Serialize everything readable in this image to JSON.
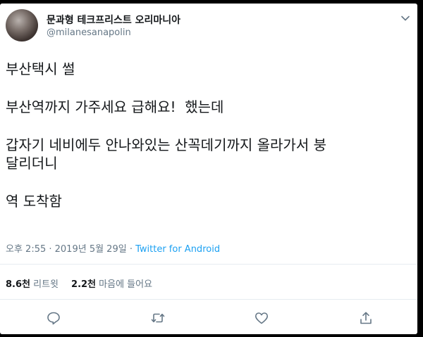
{
  "tweet": {
    "display_name": "문과형 테크프리스트 오리마니아",
    "handle": "@milanesanapolin",
    "paragraphs": [
      "부산택시 썰",
      "부산역까지 가주세요 급해요!  했는데",
      "갑자기 네비에두 안나와있는 산꼭데기까지 올라가서 붕\n달리더니",
      "역 도착함"
    ],
    "timestamp": "오후 2:55 · 2019년 5월 29일 · ",
    "source": "Twitter for Android",
    "retweet_count": "8.6천",
    "retweet_label": "리트윗",
    "like_count": "2.2천",
    "like_label": "마음에 들어요"
  },
  "icons": {
    "reply": "reply-icon",
    "retweet": "retweet-icon",
    "like": "heart-icon",
    "share": "share-icon",
    "menu": "chevron-down-icon"
  },
  "colors": {
    "text": "#14171a",
    "secondary": "#657786",
    "link": "#1da1f2"
  }
}
